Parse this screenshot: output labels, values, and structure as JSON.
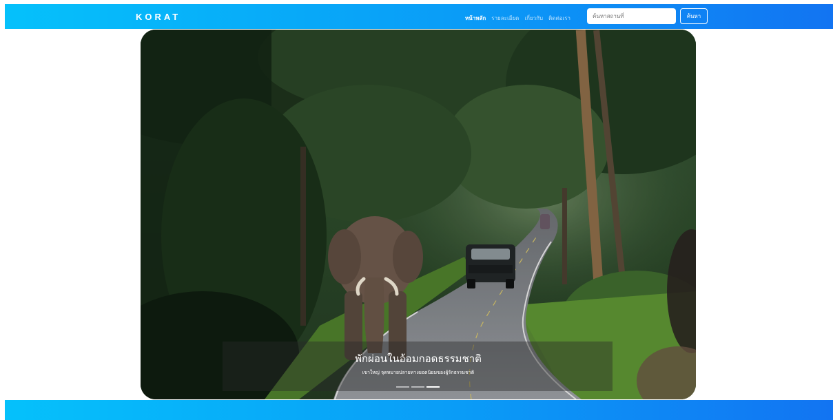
{
  "navbar": {
    "brand": "KORAT",
    "links": [
      {
        "label": "หน้าหลัก",
        "active": true
      },
      {
        "label": "รายละเอียด",
        "active": false
      },
      {
        "label": "เกี่ยวกับ",
        "active": false
      },
      {
        "label": "ติดต่อเรา",
        "active": false
      }
    ],
    "search_placeholder": "ค้นหาสถานที่",
    "search_button": "ค้นหา"
  },
  "carousel": {
    "image": "elephant-on-forest-road",
    "caption_title": "พักผ่อนในอ้อมกอดธรรมชาติ",
    "caption_text": "เขาใหญ่ จุดหมายปลายทางยอดนิยมของผู้รักธรรมชาติ",
    "slide_count": 3,
    "active_slide": 2
  },
  "colors": {
    "navbar_start": "#05c1fb",
    "navbar_end": "#1274f2",
    "background": "#ffffff"
  }
}
